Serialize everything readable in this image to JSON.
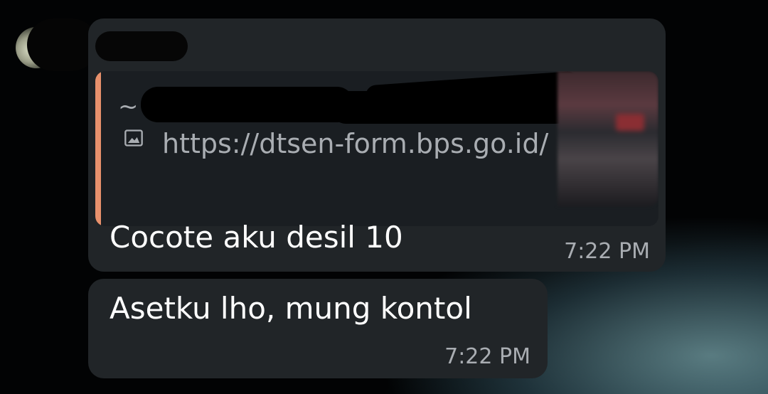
{
  "chat": {
    "messages": [
      {
        "link_preview": {
          "title_prefix": "~",
          "url": "https://dtsen-form.bps.go.id/",
          "image_icon": "image-icon",
          "accent_color": "#e8916c"
        },
        "text": "Cocote aku desil 10",
        "time": "7:22 PM"
      },
      {
        "text": "Asetku lho, mung kontol",
        "time": "7:22 PM"
      }
    ]
  },
  "theme": {
    "bubble_color": "#212528",
    "text_color": "#ffffff",
    "meta_color": "#a9adb2"
  }
}
